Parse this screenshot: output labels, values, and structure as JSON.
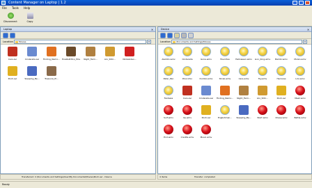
{
  "window": {
    "title": "Content Manager on Laptop | 1.2"
  },
  "menu": [
    "File",
    "Tools",
    "Help"
  ],
  "toolbar": {
    "disconnect_label": "Disconnect",
    "copy_label": "Copy"
  },
  "left": {
    "header": "Laptop",
    "location_label": "Location",
    "location_value": "Movies",
    "items": [
      {
        "name": "Cars.avi",
        "kind": "thumb",
        "color": "#c03020"
      },
      {
        "name": "Cinderella.avi",
        "kind": "thumb",
        "color": "#6a8ad0"
      },
      {
        "name": "Finding_Nemo...",
        "kind": "thumb",
        "color": "#e07020"
      },
      {
        "name": "Howl&#39;s_Movi...",
        "kind": "thumb",
        "color": "#6a4a2a"
      },
      {
        "name": "Night_Fami...",
        "kind": "thumb",
        "color": "#b08040"
      },
      {
        "name": "Lilo_Stitc...",
        "kind": "thumb",
        "color": "#d09a30"
      },
      {
        "name": "Nickelodeo...",
        "kind": "thumb",
        "color": "#d02020"
      },
      {
        "name": "Pooh.avi",
        "kind": "thumb",
        "color": "#e0b020"
      },
      {
        "name": "Sleeping_Be...",
        "kind": "thumb",
        "color": "#4a6ac0"
      },
      {
        "name": "Treasure_Pl...",
        "kind": "thumb",
        "color": "#8a6a4a"
      }
    ],
    "status_left": "",
    "status_right": "Transferred: C:\\Documents and Settings\\User\\My Documents\\Movies\\Pooh.avi - Device"
  },
  "right": {
    "header": "Device",
    "location_label": "Location",
    "location_value": "\\Documents and Settings\\Movies",
    "items": [
      {
        "name": "Aladdin.wmv",
        "kind": "star"
      },
      {
        "name": "Cinderella",
        "kind": "star"
      },
      {
        "name": "Gone.wmv",
        "kind": "star"
      },
      {
        "name": "Favorites",
        "kind": "star"
      },
      {
        "name": "Halloween.wmv",
        "kind": "star"
      },
      {
        "name": "Lion_King.wmv",
        "kind": "star"
      },
      {
        "name": "Bambi.wmv",
        "kind": "star"
      },
      {
        "name": "Mulan.wmv",
        "kind": "star"
      },
      {
        "name": "Peter_Pan",
        "kind": "star"
      },
      {
        "name": "Pinocchio",
        "kind": "star"
      },
      {
        "name": "Dumbo.wmv",
        "kind": "star"
      },
      {
        "name": "Shrek.wmv",
        "kind": "star"
      },
      {
        "name": "Cars.wmv",
        "kind": "star"
      },
      {
        "name": "Toy.wmv",
        "kind": "star"
      },
      {
        "name": "Hercules",
        "kind": "star"
      },
      {
        "name": "Lilo.wmv",
        "kind": "star"
      },
      {
        "name": "Fantasia",
        "kind": "star"
      },
      {
        "name": "Cars.avi",
        "kind": "thumb",
        "color": "#c03020"
      },
      {
        "name": "Cinderella.avi",
        "kind": "thumb",
        "color": "#6a8ad0"
      },
      {
        "name": "Finding_Nemo...",
        "kind": "thumb",
        "color": "#e07020"
      },
      {
        "name": "Night_Fami...",
        "kind": "thumb",
        "color": "#b08040"
      },
      {
        "name": "Lilo_Stitc...",
        "kind": "thumb",
        "color": "#d09a30"
      },
      {
        "name": "Pooh.avi",
        "kind": "thumb",
        "color": "#e0b020"
      },
      {
        "name": "Meet.wmv",
        "kind": "red"
      },
      {
        "name": "Surf.wmv",
        "kind": "red"
      },
      {
        "name": "Up.wmv",
        "kind": "red"
      },
      {
        "name": "Pooh.avi",
        "kind": "thumb",
        "color": "#e0b020"
      },
      {
        "name": "Englishman...",
        "kind": "star"
      },
      {
        "name": "Sleeping_Be...",
        "kind": "thumb",
        "color": "#4a6ac0"
      },
      {
        "name": "Start.wmv",
        "kind": "red"
      },
      {
        "name": "Chase.wmv",
        "kind": "red"
      },
      {
        "name": "Battle.wmv",
        "kind": "red"
      },
      {
        "name": "End.wmv",
        "kind": "red"
      },
      {
        "name": "Credits.wmv",
        "kind": "red"
      },
      {
        "name": "Music.wmv",
        "kind": "red"
      }
    ],
    "status_left": "4 items",
    "status_right": "Transfer: completed"
  },
  "statusbar": {
    "text": "Ready"
  }
}
